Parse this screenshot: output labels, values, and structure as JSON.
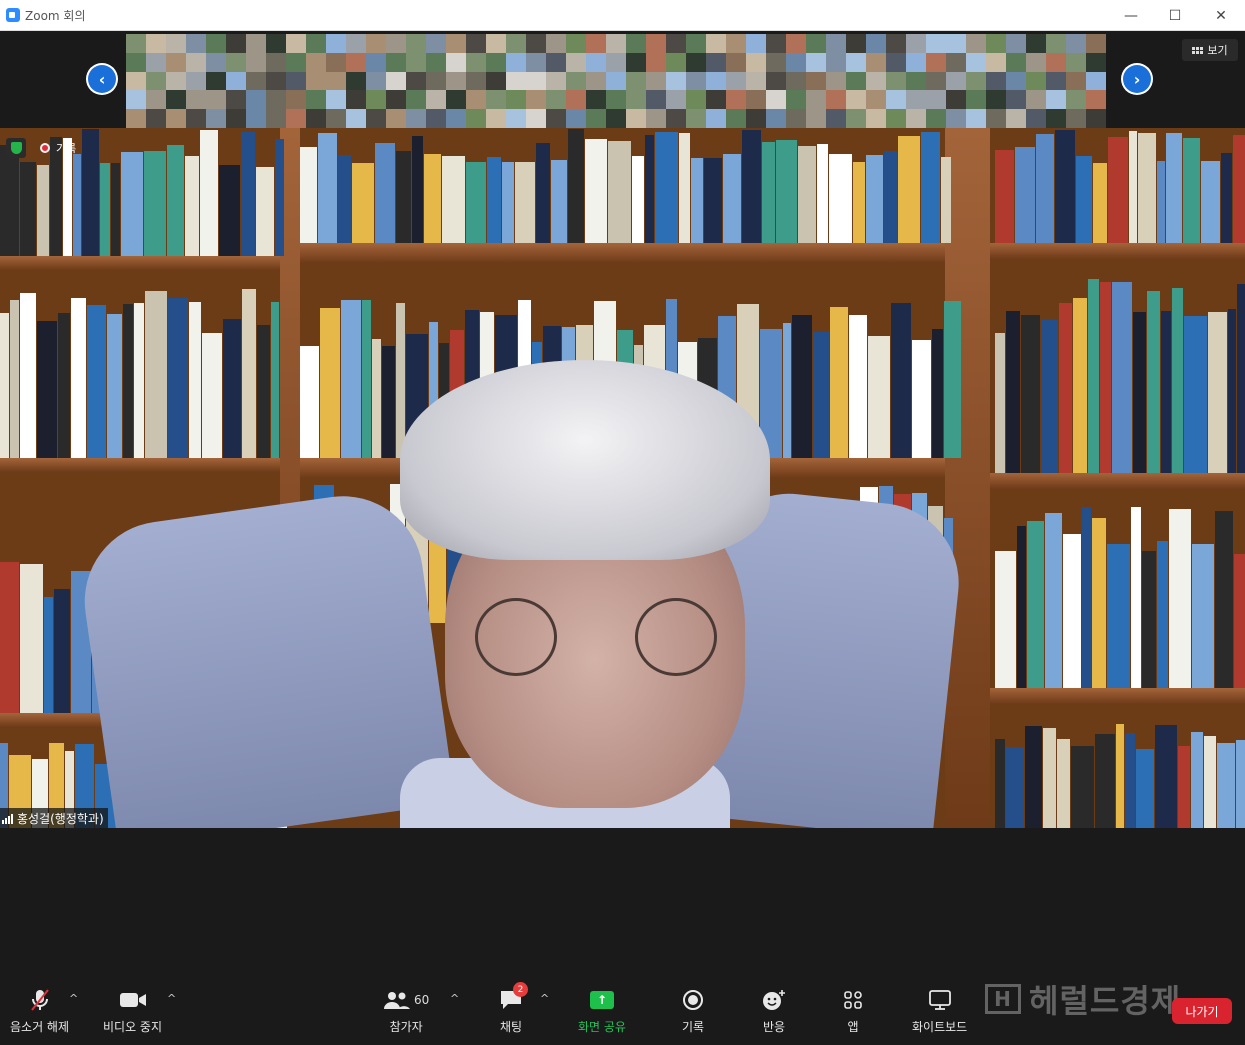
{
  "window": {
    "title": "Zoom 회의",
    "minimize_glyph": "—",
    "maximize_glyph": "☐",
    "close_glyph": "✕"
  },
  "gallery": {
    "view_label": "보기",
    "prev_glyph": "‹",
    "next_glyph": "›"
  },
  "video": {
    "recording_label": "기록",
    "participant_name": "홍성걸(행정학과)"
  },
  "toolbar": {
    "mute_label": "음소거 해제",
    "video_label": "비디오 중지",
    "participants_label": "참가자",
    "participants_count": "60",
    "chat_label": "채팅",
    "chat_badge": "2",
    "share_label": "화면 공유",
    "record_label": "기록",
    "reactions_label": "반응",
    "apps_label": "앱",
    "whiteboard_label": "화이트보드",
    "leave_label": "나가기",
    "caret_glyph": "^"
  },
  "watermark": {
    "text": "헤럴드경제"
  },
  "colors": {
    "accent_blue": "#1b6fd8",
    "share_green": "#1fbf4b",
    "leave_red": "#d9242f",
    "toolbar_bg": "#1a1a1a"
  }
}
